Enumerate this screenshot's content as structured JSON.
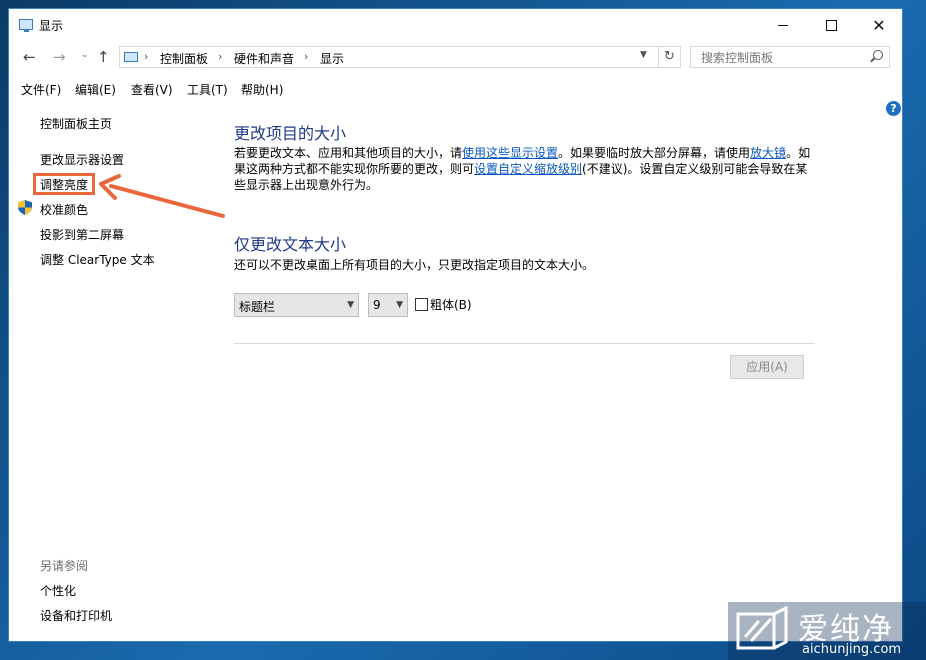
{
  "window": {
    "title": "显示",
    "controls": {
      "minimize": "–",
      "maximize": "□",
      "close": "✕"
    }
  },
  "nav": {
    "back": "←",
    "forward": "→",
    "recent": "⌄",
    "up": "↑",
    "breadcrumb": [
      "控制面板",
      "硬件和声音",
      "显示"
    ],
    "breadcrumb_sep": "›",
    "refresh": "↻",
    "search_placeholder": "搜索控制面板"
  },
  "menu": [
    "文件(F)",
    "编辑(E)",
    "查看(V)",
    "工具(T)",
    "帮助(H)"
  ],
  "help_glyph": "?",
  "sidebar": {
    "items": [
      "控制面板主页",
      "更改显示器设置",
      "调整亮度",
      "校准颜色",
      "投影到第二屏幕",
      "调整 ClearType 文本"
    ],
    "see_also_title": "另请参阅",
    "see_also": [
      "个性化",
      "设备和打印机"
    ]
  },
  "main": {
    "section1_title": "更改项目的大小",
    "section1_text": {
      "p1": "若要更改文本、应用和其他项目的大小，请",
      "link1": "使用这些显示设置",
      "p2": "。如果要临时放大部分屏幕，请使用",
      "link2": "放大镜",
      "p3": "。如果这两种方式都不能实现你所要的更改，则可",
      "link3": "设置自定义缩放级别",
      "p4": "(不建议)。设置自定义级别可能会导致在某些显示器上出现意外行为。"
    },
    "section2_title": "仅更改文本大小",
    "section2_text": "还可以不更改桌面上所有项目的大小，只更改指定项目的文本大小。",
    "element_select": "标题栏",
    "size_select": "9",
    "bold_checked": false,
    "bold_label": "粗体(B)",
    "apply_label": "应用(A)"
  },
  "watermark": {
    "title": "爱纯净",
    "subtitle": "aichunjing.com"
  },
  "colors": {
    "accent": "#0a57c2",
    "heading": "#1e3a8a",
    "highlight": "#e9673a"
  }
}
